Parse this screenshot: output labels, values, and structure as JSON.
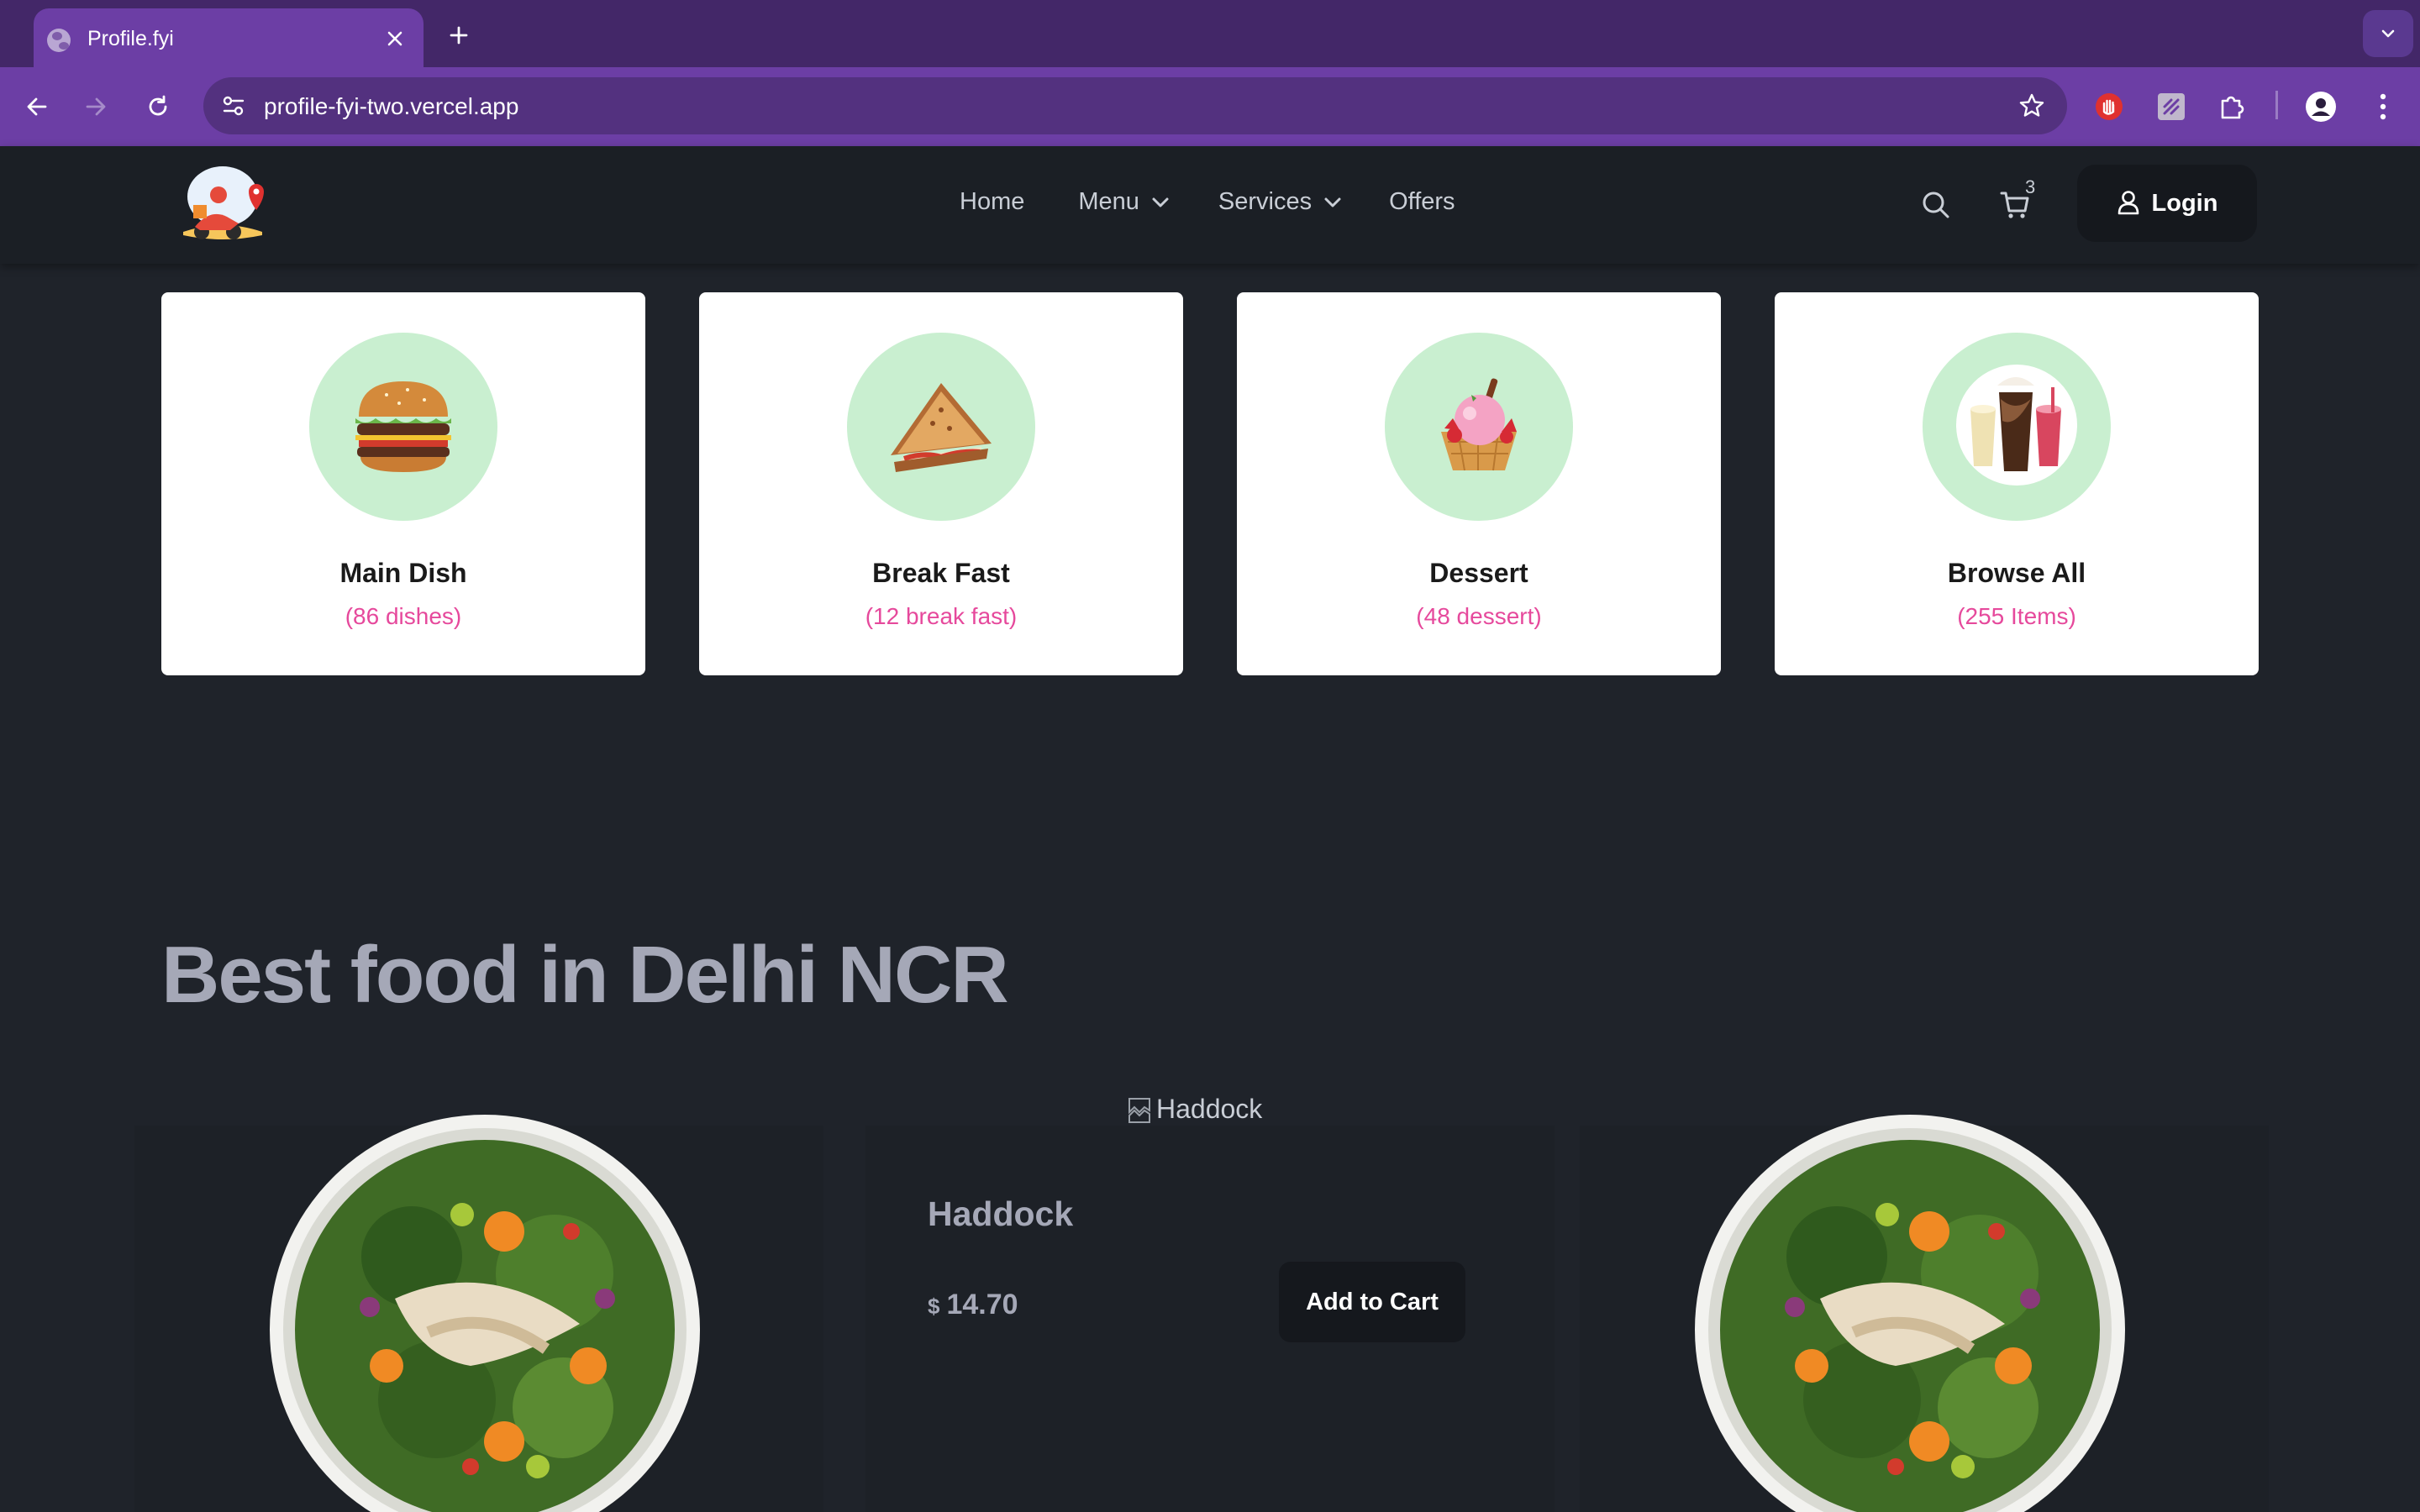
{
  "browser": {
    "tab_title": "Profile.fyi",
    "url": "profile-fyi-two.vercel.app",
    "theme_color": "#6c3ea5"
  },
  "navbar": {
    "links": [
      {
        "label": "Home"
      },
      {
        "label": "Menu"
      },
      {
        "label": "Services"
      },
      {
        "label": "Offers"
      }
    ],
    "cart_count": "3",
    "login_label": "Login"
  },
  "categories": [
    {
      "name": "Main Dish",
      "count": "(86 dishes)",
      "icon": "burger-icon"
    },
    {
      "name": "Break Fast",
      "count": "(12 break fast)",
      "icon": "sandwich-icon"
    },
    {
      "name": "Dessert",
      "count": "(48 dessert)",
      "icon": "ice-cream-icon"
    },
    {
      "name": "Browse All",
      "count": "(255 Items)",
      "icon": "drinks-icon"
    }
  ],
  "section": {
    "title": "Best food in Delhi NCR"
  },
  "featured": {
    "image_alt": "Haddock",
    "name": "Haddock",
    "currency": "$",
    "price": "14.70",
    "add_to_cart_label": "Add to Cart"
  },
  "colors": {
    "page_bg": "#1f232a",
    "card_bg": "#ffffff",
    "circle_bg": "#c9efd0",
    "count_pink": "#e6499c",
    "heading_gray": "#a5a8b7"
  }
}
